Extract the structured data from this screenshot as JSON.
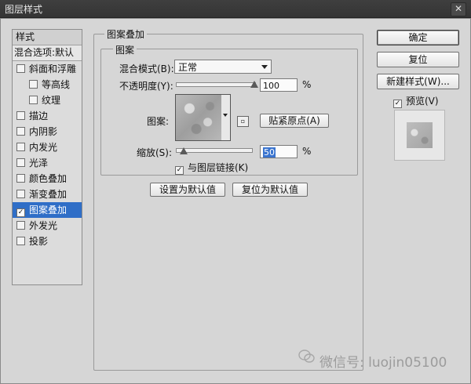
{
  "window": {
    "title": "图层样式",
    "close_glyph": "✕"
  },
  "styles_list": {
    "header": "样式",
    "blend_options": "混合选项:默认",
    "items": [
      {
        "label": "斜面和浮雕",
        "checked": false,
        "sub": false,
        "active": false
      },
      {
        "label": "等高线",
        "checked": false,
        "sub": true,
        "active": false
      },
      {
        "label": "纹理",
        "checked": false,
        "sub": true,
        "active": false
      },
      {
        "label": "描边",
        "checked": false,
        "sub": false,
        "active": false
      },
      {
        "label": "内阴影",
        "checked": false,
        "sub": false,
        "active": false
      },
      {
        "label": "内发光",
        "checked": false,
        "sub": false,
        "active": false
      },
      {
        "label": "光泽",
        "checked": false,
        "sub": false,
        "active": false
      },
      {
        "label": "颜色叠加",
        "checked": false,
        "sub": false,
        "active": false
      },
      {
        "label": "渐变叠加",
        "checked": false,
        "sub": false,
        "active": false
      },
      {
        "label": "图案叠加",
        "checked": true,
        "sub": false,
        "active": true
      },
      {
        "label": "外发光",
        "checked": false,
        "sub": false,
        "active": false
      },
      {
        "label": "投影",
        "checked": false,
        "sub": false,
        "active": false
      }
    ]
  },
  "panel": {
    "group_title": "图案叠加",
    "subgroup_title": "图案",
    "blend_mode_label": "混合模式(B):",
    "blend_mode_value": "正常",
    "opacity_label": "不透明度(Y):",
    "opacity_value": "100",
    "opacity_fraction": 1.0,
    "percent": "%",
    "pattern_label": "图案:",
    "snap_origin_label": "贴紧原点(A)",
    "scale_label": "缩放(S):",
    "scale_value": "50",
    "scale_fraction": 0.1,
    "link_label": "与图层链接(K)",
    "link_checked": true,
    "make_default_label": "设置为默认值",
    "reset_default_label": "复位为默认值"
  },
  "right": {
    "ok_label": "确定",
    "reset_label": "复位",
    "new_style_label": "新建样式(W)...",
    "preview_label": "预览(V)",
    "preview_checked": true
  },
  "watermark": {
    "text": "微信号: luojin05100"
  },
  "check_glyph": "✓",
  "new_pattern_glyph": "▫"
}
